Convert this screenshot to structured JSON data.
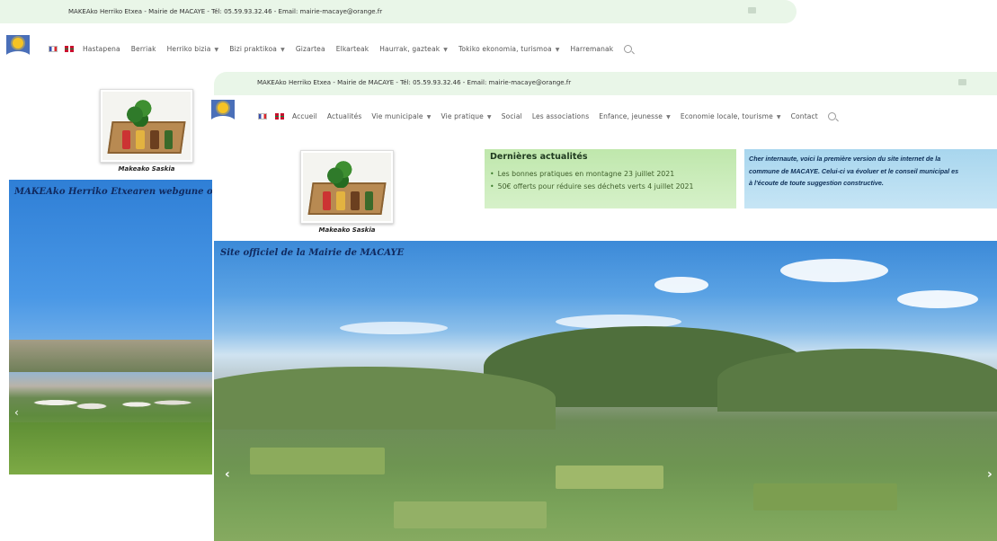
{
  "back": {
    "topbar": "MAKEAko Herriko Etxea - Mairie de MACAYE - Tél: 05.59.93.32.46 - Email: mairie-macaye@orange.fr",
    "nav": [
      "Hastapena",
      "Berriak",
      "Herriko bizia",
      "Bizi praktikoa",
      "Gizartea",
      "Elkarteak",
      "Haurrak, gazteak",
      "Tokiko ekonomia, turismoa",
      "Harremanak"
    ],
    "logo_caption": "Makeako Saskia",
    "hero_title": "MAKEAko Herriko Etxearen webgune ofi",
    "prev_arrow": "‹"
  },
  "front": {
    "topbar": "MAKEAko Herriko Etxea - Mairie de MACAYE - Tél: 05.59.93.32.46 - Email: mairie-macaye@orange.fr",
    "nav": [
      "Accueil",
      "Actualités",
      "Vie municipale",
      "Vie pratique",
      "Social",
      "Les associations",
      "Enfance, jeunesse",
      "Economie locale, tourisme",
      "Contact"
    ],
    "logo_caption": "Makeako Saskia",
    "news": {
      "title": "Dernières actualités",
      "items": [
        "Les bonnes pratiques en montagne 23 juillet 2021",
        "50€ offerts pour réduire ses déchets verts 4 juillet 2021"
      ]
    },
    "welcome": {
      "line1": "Cher internaute, voici la première version du site internet de la",
      "line2": "commune de MACAYE. Celui-ci va évoluer et le conseil municipal es",
      "line3": "à l'écoute de toute suggestion constructive."
    },
    "hero_title": "Site officiel de la Mairie de MACAYE",
    "prev_arrow": "‹",
    "next_arrow": "›"
  },
  "icons": [
    "sun-logo-icon",
    "flag-fr-icon",
    "flag-basque-icon",
    "search-icon",
    "email-icon",
    "chevron-down-icon"
  ],
  "colors": {
    "topbar_bg": "#e9f6e8",
    "news_bg": "#c9ebb9",
    "welcome_bg": "#b3dcf1",
    "title_text": "#102a60"
  }
}
